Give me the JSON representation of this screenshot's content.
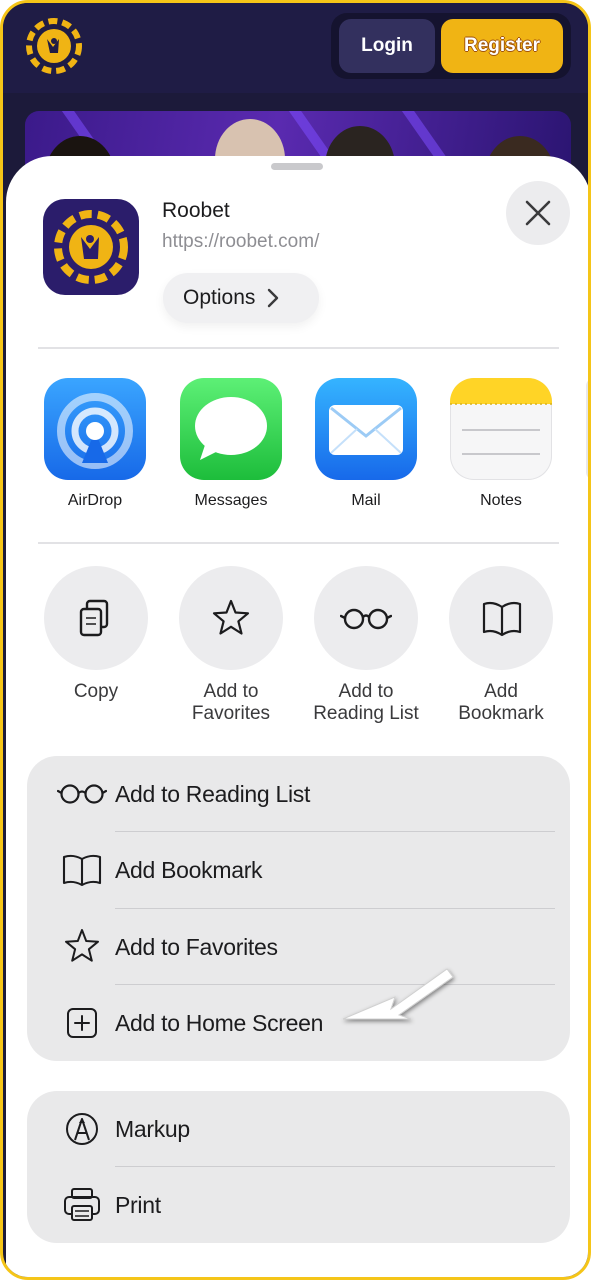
{
  "header": {
    "login_label": "Login",
    "register_label": "Register",
    "brand_color": "#f0b414",
    "background_color": "#1f1c45"
  },
  "share_sheet": {
    "site_title": "Roobet",
    "site_url": "https://roobet.com/",
    "options_label": "Options",
    "share_targets": [
      {
        "label": "AirDrop",
        "icon": "airdrop-icon"
      },
      {
        "label": "Messages",
        "icon": "messages-icon"
      },
      {
        "label": "Mail",
        "icon": "mail-icon"
      },
      {
        "label": "Notes",
        "icon": "notes-icon"
      }
    ],
    "quick_actions": [
      {
        "line1": "Copy",
        "line2": "",
        "icon": "copy-icon"
      },
      {
        "line1": "Add to",
        "line2": "Favorites",
        "icon": "star-icon"
      },
      {
        "line1": "Add to",
        "line2": "Reading List",
        "icon": "glasses-icon"
      },
      {
        "line1": "Add",
        "line2": "Bookmark",
        "icon": "book-icon"
      }
    ],
    "list_group_1": [
      {
        "label": "Add to Reading List",
        "icon": "glasses-icon"
      },
      {
        "label": "Add Bookmark",
        "icon": "book-icon"
      },
      {
        "label": "Add to Favorites",
        "icon": "star-icon"
      },
      {
        "label": "Add to Home Screen",
        "icon": "plus-square-icon"
      }
    ],
    "list_group_2": [
      {
        "label": "Markup",
        "icon": "markup-icon"
      },
      {
        "label": "Print",
        "icon": "printer-icon"
      }
    ]
  }
}
